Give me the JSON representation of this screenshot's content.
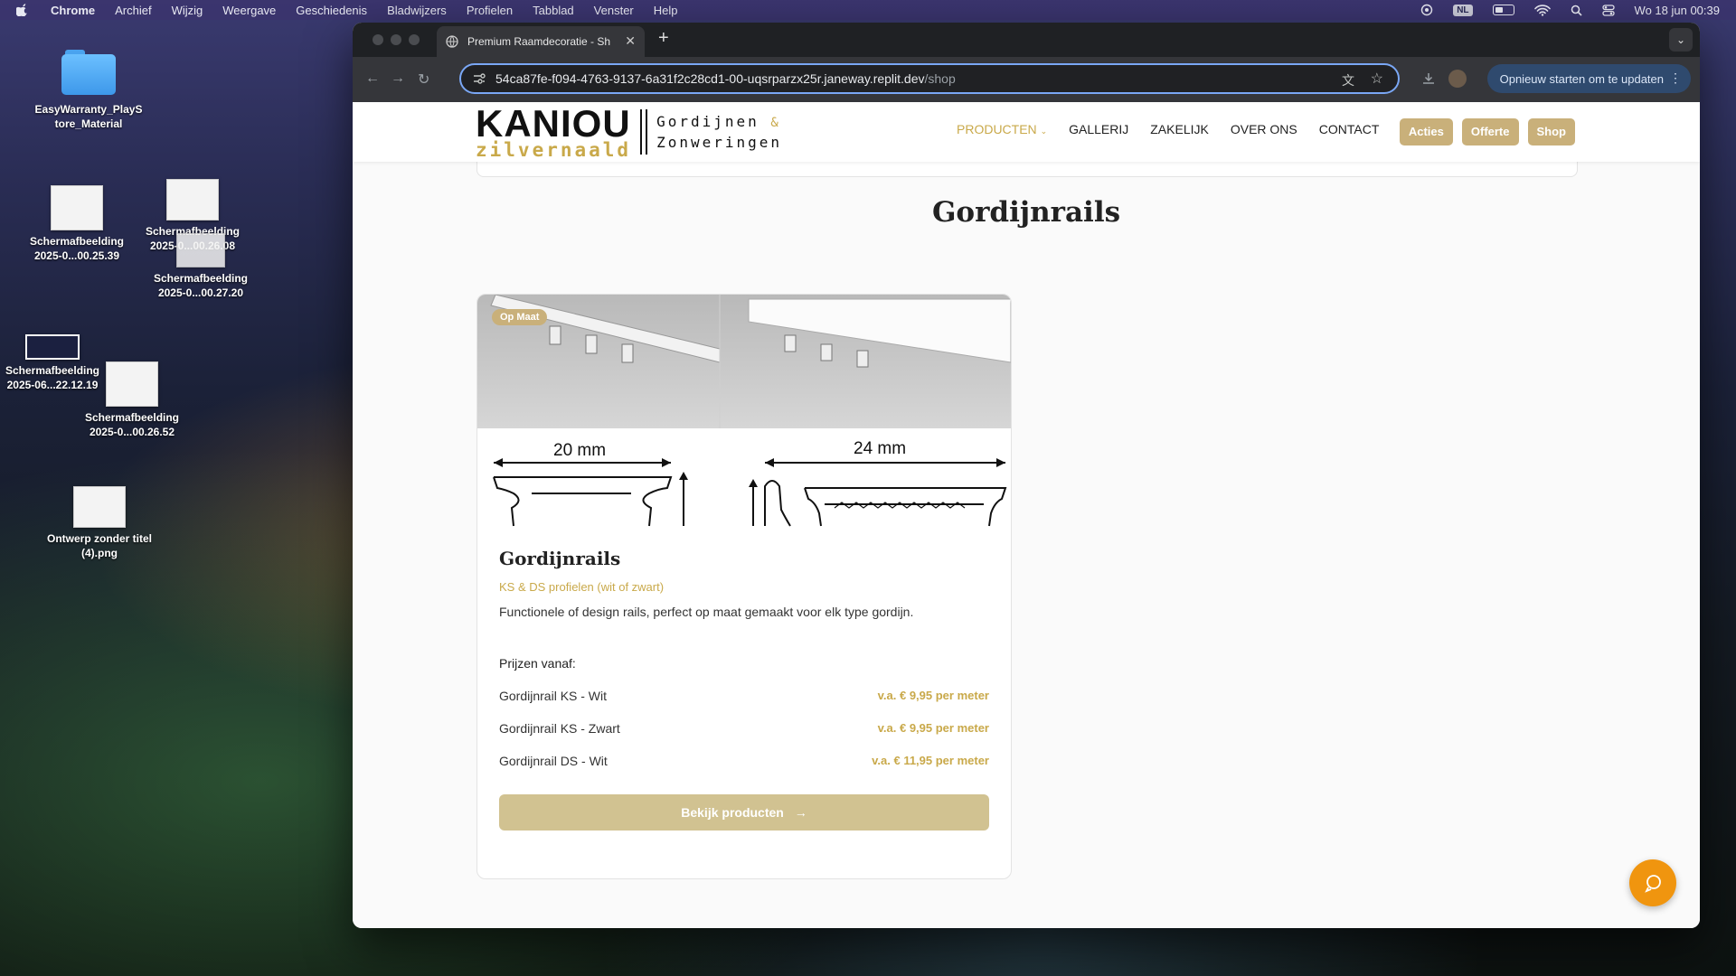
{
  "menubar": {
    "items": [
      "Chrome",
      "Archief",
      "Wijzig",
      "Weergave",
      "Geschiedenis",
      "Bladwijzers",
      "Profielen",
      "Tabblad",
      "Venster",
      "Help"
    ],
    "lang_badge": "NL",
    "clock": "Wo 18 jun  00:39"
  },
  "desktop": {
    "icons": [
      {
        "label": "EasyWarranty_PlayStore_Material"
      },
      {
        "label": "Schermafbeelding 2025-0...00.25.39"
      },
      {
        "label": "Schermafbeelding 2025-0...00.26.08"
      },
      {
        "label": "Schermafbeelding 2025-0...00.27.20"
      },
      {
        "label": "Schermafbeelding 2025-06...22.12.19"
      },
      {
        "label": "Schermafbeelding 2025-0...00.26.52"
      },
      {
        "label": "Ontwerp zonder titel (4).png"
      }
    ]
  },
  "browser": {
    "tab_title": "Premium Raamdecoratie - Sh",
    "url_main": "54ca87fe-f094-4763-9137-6a31f2c28cd1-00-uqsrparzx25r.janeway.replit.dev",
    "url_path": "/shop",
    "update_label": "Opnieuw starten om te updaten"
  },
  "site": {
    "logo": {
      "kaniou": "KANIOU",
      "zilvernaald": "zilvernaald",
      "line1": "Gordijnen",
      "amp": "&",
      "line2": "Zonweringen"
    },
    "nav": [
      "PRODUCTEN",
      "GALLERIJ",
      "ZAKELIJK",
      "OVER ONS",
      "CONTACT"
    ],
    "buttons": [
      "Acties",
      "Offerte",
      "Shop"
    ],
    "section_title": "Gordijnrails",
    "card": {
      "badge": "Op Maat",
      "dim_left": "20 mm",
      "dim_right": "24 mm",
      "title": "Gordijnrails",
      "subtitle": "KS & DS profielen (wit of zwart)",
      "description": "Functionele of design rails, perfect op maat gemaakt voor elk type gordijn.",
      "prices_heading": "Prijzen vanaf:",
      "prices": [
        {
          "name": "Gordijnrail KS - Wit",
          "price": "v.a. € 9,95 per meter"
        },
        {
          "name": "Gordijnrail KS - Zwart",
          "price": "v.a. € 9,95 per meter"
        },
        {
          "name": "Gordijnrail DS - Wit",
          "price": "v.a. € 11,95 per meter"
        }
      ],
      "cta": "Bekijk producten"
    }
  },
  "colors": {
    "gold": "#c9a94a",
    "button_gold": "#c9b07a",
    "chat_orange": "#f0950f"
  }
}
